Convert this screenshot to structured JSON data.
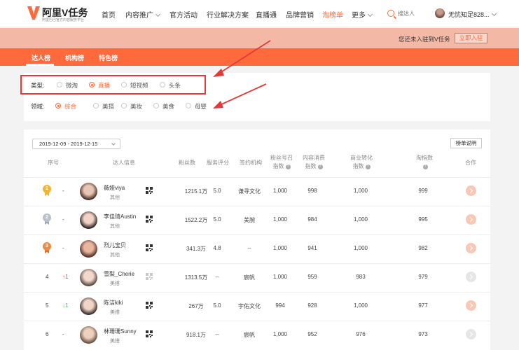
{
  "nav": {
    "logo_text": "阿里V任务",
    "logo_subtitle": "阿里巴巴官方内容服务平台",
    "items": [
      "首页",
      "内容推广",
      "官方活动",
      "行业解决方案",
      "直播通",
      "品牌营销",
      "淘榜单",
      "更多"
    ],
    "active_item": "淘榜单",
    "search_placeholder": "搜达人",
    "user_name": "无忧知足828..."
  },
  "banner": {
    "text": "您还未入驻到V任务",
    "button": "立即入驻"
  },
  "tabs": [
    "达人榜",
    "机构榜",
    "特色榜"
  ],
  "filters": {
    "type_label": "类型:",
    "type_options": [
      "微淘",
      "直播",
      "短视频",
      "头条"
    ],
    "type_selected": "直播",
    "domain_label": "领域:",
    "domain_options": [
      "综合",
      "美搭",
      "美妆",
      "美食",
      "母婴"
    ],
    "domain_selected": "综合"
  },
  "table": {
    "date_range": "2019-12-09 - 2019-12-15",
    "rank_help": "榜单说明",
    "headers": {
      "rank": "序号",
      "info": "达人信息",
      "fans": "粉丝数",
      "score": "服务评分",
      "agency": "签约机构",
      "fans_index_1": "粉丝号召",
      "fans_index_2": "指数",
      "consume_1": "内容消费",
      "consume_2": "指数",
      "biz_1": "商业转化",
      "biz_2": "指数",
      "tao_1": "淘指数",
      "coop": "合作"
    },
    "rows": [
      {
        "rank": "1",
        "trend": "-",
        "name": "薇娅viya",
        "category": "其他",
        "fans": "1215.1万",
        "score": "5.0",
        "agency": "谦寻文化",
        "fans_index": "1,000",
        "consume": "998",
        "biz": "1,000",
        "tao": "999"
      },
      {
        "rank": "2",
        "trend": "-",
        "name": "李佳琦Austin",
        "category": "其他",
        "fans": "1522.2万",
        "score": "5.0",
        "agency": "美腕",
        "fans_index": "1,000",
        "consume": "984",
        "biz": "1,000",
        "tao": "995"
      },
      {
        "rank": "3",
        "trend": "-",
        "name": "烈儿宝贝",
        "category": "其他",
        "fans": "341.3万",
        "score": "4.8",
        "agency": "--",
        "fans_index": "1,000",
        "consume": "941",
        "biz": "1,000",
        "tao": "982"
      },
      {
        "rank": "4",
        "trend": "↑1",
        "name": "雪梨_Cherie",
        "category": "美搭",
        "fans": "1313.5万",
        "score": "--",
        "agency": "宸帆",
        "fans_index": "1,000",
        "consume": "959",
        "biz": "983",
        "tao": "979"
      },
      {
        "rank": "5",
        "trend": "↓1",
        "name": "陈洁kiki",
        "category": "美搭",
        "fans": "267万",
        "score": "5.0",
        "agency": "宇佑文化",
        "fans_index": "994",
        "consume": "928",
        "biz": "1,000",
        "tao": "977"
      },
      {
        "rank": "6",
        "trend": "-",
        "name": "林珊珊Sunny",
        "category": "美搭",
        "fans": "918.1万",
        "score": "--",
        "agency": "宸帆",
        "fans_index": "1,000",
        "consume": "952",
        "biz": "976",
        "tao": "973"
      }
    ]
  },
  "colors": {
    "accent": "#ff6a3d",
    "banner_bg": "#f4b9a6",
    "highlight_box": "#e53935"
  }
}
